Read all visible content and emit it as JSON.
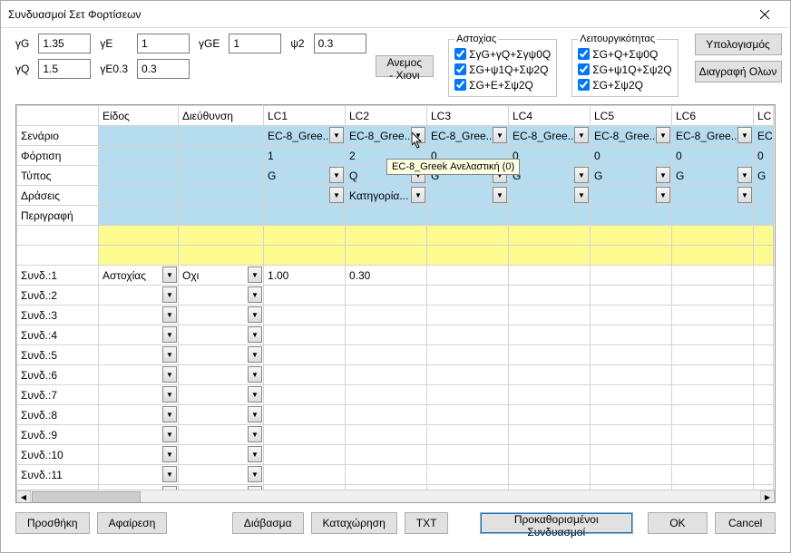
{
  "window": {
    "title": "Συνδυασμοί Σετ Φορτίσεων"
  },
  "factors": {
    "gG_label": "γG",
    "gG": "1.35",
    "gE_label": "γE",
    "gE": "1",
    "gGE_label": "γGE",
    "gGE": "1",
    "psi2_label": "ψ2",
    "psi2": "0.3",
    "gQ_label": "γQ",
    "gQ": "1.5",
    "gE03_label": "γE0.3",
    "gE03": "0.3"
  },
  "wind_snow": "Ανεμος - Χιονι",
  "groupA": {
    "legend": "Αστοχίας",
    "c1": "ΣγG+γQ+Σγψ0Q",
    "c2": "ΣG+ψ1Q+Σψ2Q",
    "c3": "ΣG+E+Σψ2Q"
  },
  "groupB": {
    "legend": "Λειτουργικότητας",
    "c1": "ΣG+Q+Σψ0Q",
    "c2": "ΣG+ψ1Q+Σψ2Q",
    "c3": "ΣG+Σψ2Q"
  },
  "calc": "Υπολογισμός",
  "del_all": "Διαγραφή Ολων",
  "headers": {
    "h1": "Είδος",
    "h2": "Διεύθυνση",
    "lc1": "LC1",
    "lc2": "LC2",
    "lc3": "LC3",
    "lc4": "LC4",
    "lc5": "LC5",
    "lc6": "LC6",
    "lc7": "LC"
  },
  "rows": {
    "scenario": "Σενάριο",
    "load": "Φόρτιση",
    "type": "Τύπος",
    "actions": "Δράσεις",
    "desc": "Περιγραφή"
  },
  "scenario_val": "EC-8_Gree...",
  "scenario_lc7": "EC",
  "load_vals": {
    "lc1": "1",
    "lc2": "2",
    "lc3": "0",
    "lc4": "0",
    "lc5": "0",
    "lc6": "0",
    "lc7": "0"
  },
  "type_vals": {
    "lc1": "G",
    "lc2": "Q",
    "lc3": "G",
    "lc4": "G",
    "lc5": "G",
    "lc6": "G",
    "lc7": "G"
  },
  "actions_lc2": "Κατηγορία...",
  "comb": {
    "prefix": "Συνδ.:",
    "astoxias": "Αστοχίας",
    "oxi": "Οχι",
    "v1": "1.00",
    "v2": "0.30"
  },
  "tooltip": "EC-8_Greek Ανελαστική (0)",
  "buttons": {
    "add": "Προσθήκη",
    "remove": "Αφαίρεση",
    "read": "Διάβασμα",
    "save": "Καταχώρηση",
    "txt": "TXT",
    "default": "Προκαθορισμένοι Συνδυασμοί",
    "ok": "OK",
    "cancel": "Cancel"
  }
}
